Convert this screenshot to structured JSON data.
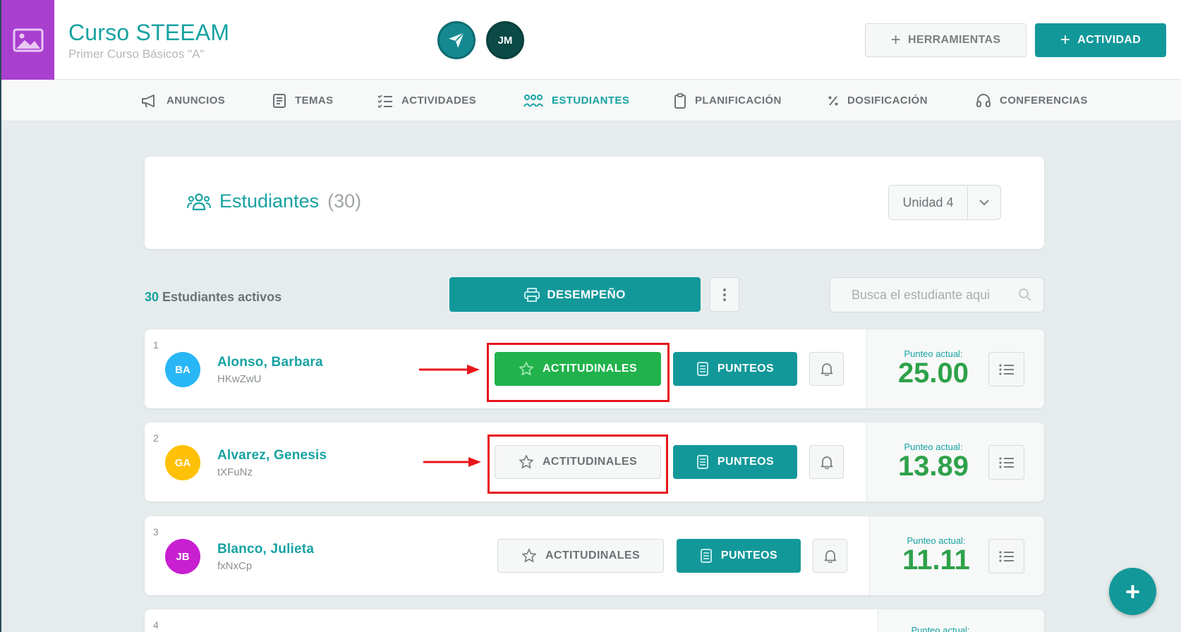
{
  "header": {
    "course_title": "Curso STEEAM",
    "course_subtitle": "Primer Curso Básicos \"A\"",
    "user_initials": "JM",
    "tools_label": "HERRAMIENTAS",
    "activity_label": "ACTIVIDAD"
  },
  "nav": {
    "items": [
      {
        "label": "ANUNCIOS",
        "icon": "megaphone-icon"
      },
      {
        "label": "TEMAS",
        "icon": "book-icon"
      },
      {
        "label": "ACTIVIDADES",
        "icon": "checklist-icon"
      },
      {
        "label": "ESTUDIANTES",
        "icon": "students-icon",
        "active": true
      },
      {
        "label": "PLANIFICACIÓN",
        "icon": "clipboard-icon"
      },
      {
        "label": "DOSIFICACIÓN",
        "icon": "percent-icon"
      },
      {
        "label": "CONFERENCIAS",
        "icon": "headset-icon"
      }
    ]
  },
  "panel": {
    "title": "Estudiantes",
    "count": "(30)",
    "unit_select": "Unidad 4"
  },
  "toolbar": {
    "active_count": "30",
    "active_label": "Estudiantes activos",
    "performance_label": "DESEMPEÑO",
    "search_placeholder": "Busca el estudiante aqui"
  },
  "colors": {
    "accent": "#13989a",
    "green": "#22b24c",
    "score": "#2ea14a",
    "highlight": "#e8151c",
    "course_image": "#a93fcf"
  },
  "students": [
    {
      "index": "1",
      "initials": "BA",
      "name": "Alonso, Barbara",
      "code": "HKwZwU",
      "attitude_label": "ACTITUDINALES",
      "attitude_state": "active",
      "scores_label": "PUNTEOS",
      "score_label": "Punteo actual:",
      "score": "25.00",
      "avatar_color": "#29b6f6"
    },
    {
      "index": "2",
      "initials": "GA",
      "name": "Alvarez, Genesis",
      "code": "tXFuNz",
      "attitude_label": "ACTITUDINALES",
      "attitude_state": "inactive",
      "scores_label": "PUNTEOS",
      "score_label": "Punteo actual:",
      "score": "13.89",
      "avatar_color": "#ffc107"
    },
    {
      "index": "3",
      "initials": "JB",
      "name": "Blanco, Julieta",
      "code": "fxNxCp",
      "attitude_label": "ACTITUDINALES",
      "attitude_state": "inactive",
      "scores_label": "PUNTEOS",
      "score_label": "Punteo actual:",
      "score": "11.11",
      "avatar_color": "#c81fd1"
    },
    {
      "index": "4",
      "score_label": "Punteo actual:"
    }
  ]
}
